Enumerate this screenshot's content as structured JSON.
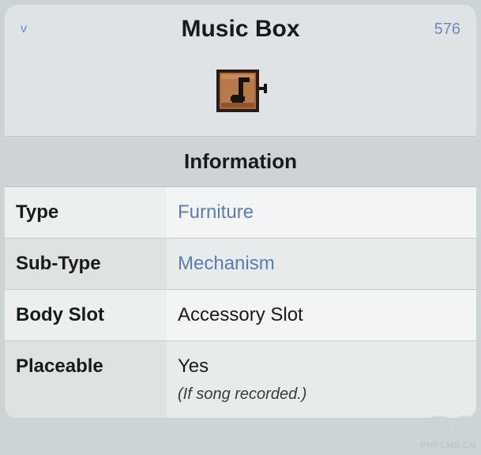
{
  "header": {
    "left": "v",
    "title": "Music Box",
    "right": "576"
  },
  "icon_name": "music-box-icon",
  "section_title": "Information",
  "rows": [
    {
      "label": "Type",
      "value": "Furniture",
      "link": true
    },
    {
      "label": "Sub-Type",
      "value": "Mechanism",
      "link": true
    },
    {
      "label": "Body Slot",
      "value": "Accessory Slot",
      "link": false
    },
    {
      "label": "Placeable",
      "value": "Yes",
      "note": "(If song recorded.)",
      "link": false
    }
  ],
  "watermark": {
    "big": "PC",
    "small": "PHPCMS.CN"
  }
}
